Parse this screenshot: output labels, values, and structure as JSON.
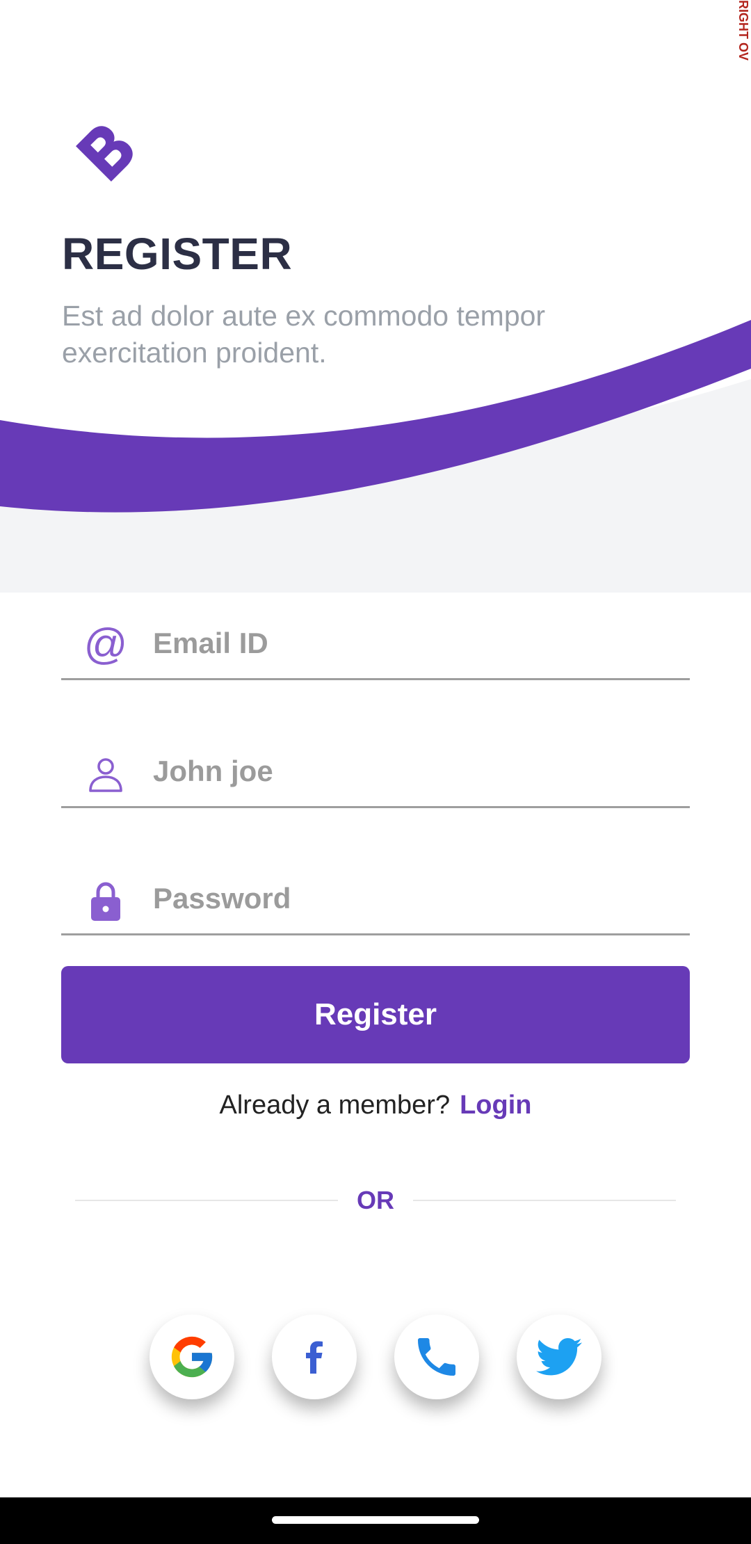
{
  "debug_banner": "RIGHT OV",
  "header": {
    "title": "REGISTER",
    "subtitle": "Est ad dolor aute ex commodo tempor exercitation proident."
  },
  "form": {
    "email_placeholder": "Email ID",
    "name_placeholder": "John joe",
    "password_placeholder": "Password",
    "register_label": "Register"
  },
  "footer": {
    "member_text": "Already a member?",
    "login_label": "Login",
    "or_text": "OR"
  },
  "social": [
    {
      "icon": "google-icon"
    },
    {
      "icon": "facebook-icon"
    },
    {
      "icon": "phone-icon"
    },
    {
      "icon": "twitter-icon"
    }
  ],
  "colors": {
    "accent": "#673ab7",
    "title": "#2c2f45",
    "subtitle": "#9aa0a8",
    "wave_light": "#f3f4f6",
    "facebook": "#3b5fd2",
    "phone": "#1e88e5",
    "twitter": "#1da1f2"
  }
}
